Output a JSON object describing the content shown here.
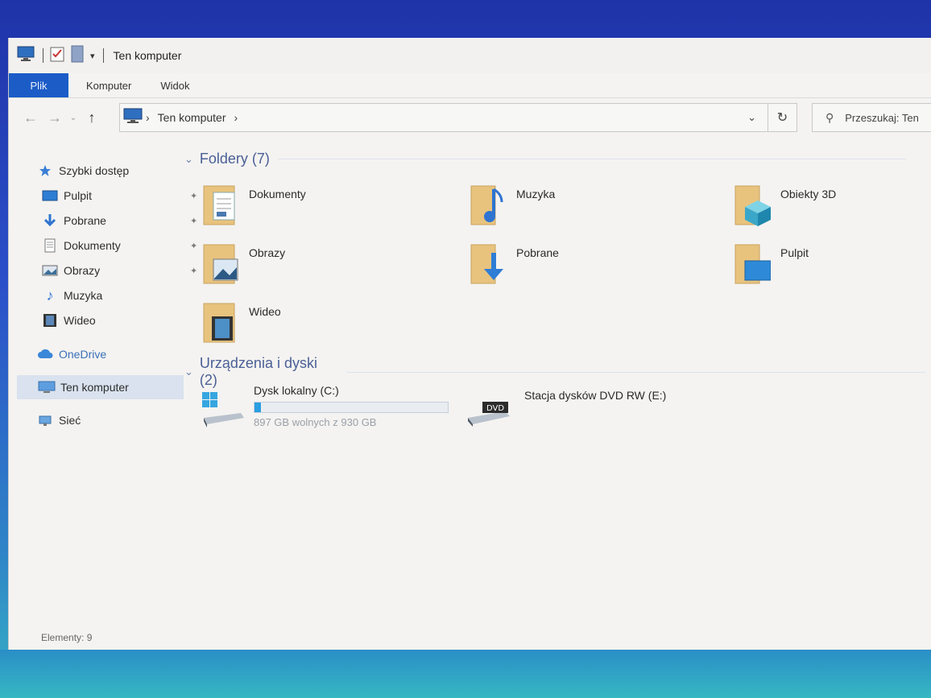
{
  "window": {
    "title": "Ten komputer"
  },
  "ribbon": {
    "tabs": [
      "Plik",
      "Komputer",
      "Widok"
    ]
  },
  "address": {
    "path": "Ten komputer",
    "search_placeholder": "Przeszukaj: Ten"
  },
  "sidebar": {
    "items": [
      {
        "label": "Szybki dostęp",
        "icon": "star-icon",
        "pinned": false
      },
      {
        "label": "Pulpit",
        "icon": "desktop-icon",
        "pinned": true
      },
      {
        "label": "Pobrane",
        "icon": "download-icon",
        "pinned": true
      },
      {
        "label": "Dokumenty",
        "icon": "document-icon",
        "pinned": true
      },
      {
        "label": "Obrazy",
        "icon": "pictures-icon",
        "pinned": true
      },
      {
        "label": "Muzyka",
        "icon": "music-icon",
        "pinned": false
      },
      {
        "label": "Wideo",
        "icon": "video-icon",
        "pinned": false
      },
      {
        "label": "OneDrive",
        "icon": "cloud-icon",
        "pinned": false
      },
      {
        "label": "Ten komputer",
        "icon": "computer-icon",
        "pinned": false,
        "selected": true
      },
      {
        "label": "Sieć",
        "icon": "network-icon",
        "pinned": false
      }
    ]
  },
  "folders_section": {
    "title": "Foldery (7)",
    "items": [
      {
        "name": "Dokumenty",
        "icon": "documents-folder-icon"
      },
      {
        "name": "Muzyka",
        "icon": "music-folder-icon"
      },
      {
        "name": "Obiekty 3D",
        "icon": "3d-objects-folder-icon"
      },
      {
        "name": "Obrazy",
        "icon": "pictures-folder-icon"
      },
      {
        "name": "Pobrane",
        "icon": "downloads-folder-icon"
      },
      {
        "name": "Pulpit",
        "icon": "desktop-folder-icon"
      },
      {
        "name": "Wideo",
        "icon": "videos-folder-icon"
      }
    ]
  },
  "drives_section": {
    "title": "Urządzenia i dyski (2)",
    "items": [
      {
        "name": "Dysk lokalny (C:)",
        "free_text": "897 GB wolnych z 930 GB",
        "used_fraction": 0.035,
        "icon": "windows-drive-icon"
      },
      {
        "name": "Stacja dysków DVD RW (E:)",
        "icon": "dvd-drive-icon",
        "badge": "DVD"
      }
    ]
  },
  "status": {
    "text": "Elementy: 9"
  },
  "colors": {
    "accent": "#1c5cc7",
    "section_title": "#4a5f96",
    "selected_bg": "#d9e2ee",
    "folder": "#e8c37e"
  }
}
